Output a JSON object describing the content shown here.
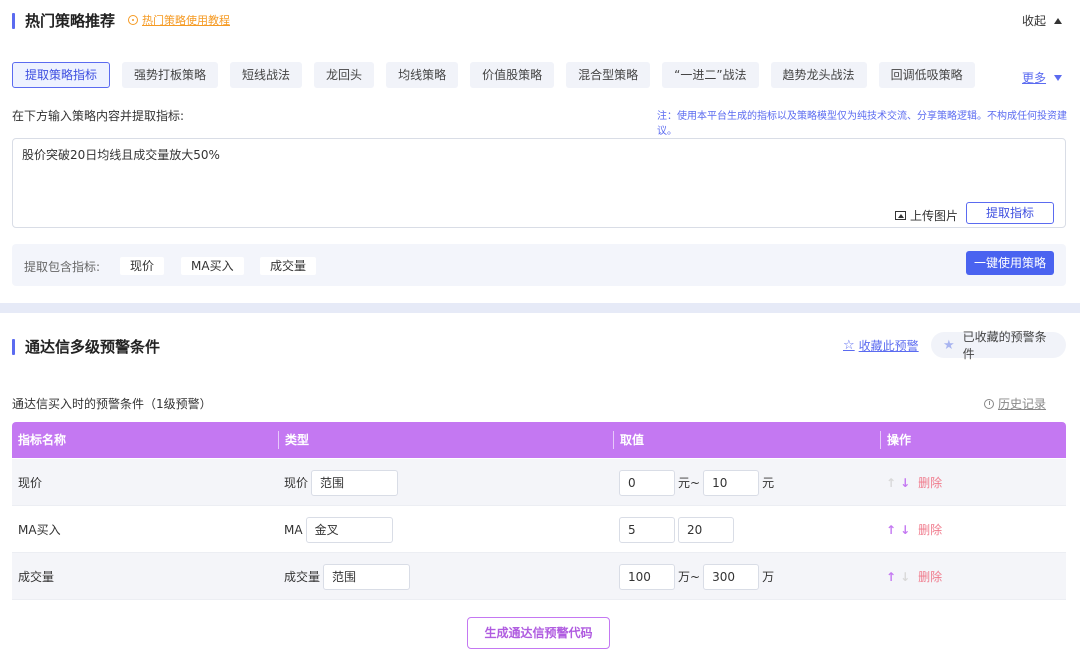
{
  "strategy": {
    "title": "热门策略推荐",
    "tutorial_link": "热门策略使用教程",
    "collapse_label": "收起",
    "tabs": [
      {
        "label": "提取策略指标",
        "active": true
      },
      {
        "label": "强势打板策略",
        "active": false
      },
      {
        "label": "短线战法",
        "active": false
      },
      {
        "label": "龙回头",
        "active": false
      },
      {
        "label": "均线策略",
        "active": false
      },
      {
        "label": "价值股策略",
        "active": false
      },
      {
        "label": "混合型策略",
        "active": false
      },
      {
        "label": "“一进二”战法",
        "active": false
      },
      {
        "label": "趋势龙头战法",
        "active": false
      },
      {
        "label": "回调低吸策略",
        "active": false
      }
    ],
    "more_label": "更多",
    "prompt_label": "在下方输入策略内容并提取指标:",
    "disclaimer": "注：使用本平台生成的指标以及策略模型仅为纯技术交流、分享策略逻辑。不构成任何投资建议。",
    "input_text": "股价突破20日均线且成交量放大50%",
    "upload_label": "上传图片",
    "extract_button": "提取指标",
    "result_label": "提取包含指标:",
    "result_chips": [
      "现价",
      "MA买入",
      "成交量"
    ],
    "use_strategy_button": "一键使用策略"
  },
  "alert": {
    "title": "通达信多级预警条件",
    "favorite_link": "收藏此预警",
    "favorites_button": "已收藏的预警条件",
    "level_label": "通达信买入时的预警条件（1级预警）",
    "history_link": "历史记录",
    "columns": [
      "指标名称",
      "类型",
      "取值",
      "操作"
    ],
    "rows": [
      {
        "name": "现价",
        "type_prefix": "现价",
        "type_value": "范围",
        "v1": "0",
        "u1": "元~",
        "v2": "10",
        "u2": "元",
        "up_enabled": false,
        "down_enabled": true,
        "delete": "删除"
      },
      {
        "name": "MA买入",
        "type_prefix": "MA",
        "type_value": "金叉",
        "v1": "5",
        "u1": "",
        "v2": "20",
        "u2": "",
        "up_enabled": true,
        "down_enabled": true,
        "delete": "删除"
      },
      {
        "name": "成交量",
        "type_prefix": "成交量",
        "type_value": "范围",
        "v1": "100",
        "u1": "万~",
        "v2": "300",
        "u2": "万",
        "up_enabled": true,
        "down_enabled": false,
        "delete": "删除"
      }
    ],
    "generate_button": "生成通达信预警代码"
  },
  "colors": {
    "accent": "#5b6bf0",
    "table_header": "#c478f2",
    "tutorial": "#f59a23",
    "delete": "#f07a8c"
  },
  "icons": {
    "tutorial": "play-circle-icon",
    "collapse": "caret-up-icon",
    "more": "caret-down-icon",
    "upload": "image-icon",
    "favorite": "star-outline-icon",
    "favorites": "star-filled-icon",
    "history": "clock-icon",
    "move_up": "arrow-up-icon",
    "move_down": "arrow-down-icon"
  }
}
